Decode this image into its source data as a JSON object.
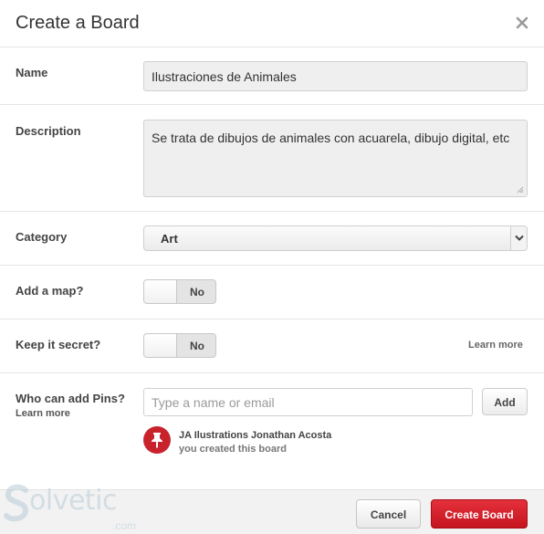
{
  "dialog": {
    "title": "Create a Board"
  },
  "name_field": {
    "label": "Name",
    "value": "Ilustraciones de Animales"
  },
  "description_field": {
    "label": "Description",
    "value": "Se trata de dibujos de animales con acuarela, dibujo digital, etc"
  },
  "category_field": {
    "label": "Category",
    "selected": "Art"
  },
  "map_field": {
    "label": "Add a map?",
    "state": "No"
  },
  "secret_field": {
    "label": "Keep it secret?",
    "state": "No",
    "learn_more": "Learn more"
  },
  "collaborators": {
    "label": "Who can add Pins?",
    "learn_more": "Learn more",
    "placeholder": "Type a name or email",
    "add_label": "Add",
    "owner_name": "JA Ilustrations Jonathan Acosta",
    "owner_note": "you created this board"
  },
  "footer": {
    "cancel_label": "Cancel",
    "create_label": "Create Board"
  },
  "watermark": {
    "brand": "olvetic",
    "domain": ".com"
  },
  "colors": {
    "primary": "#c8232c",
    "border": "#e6e6e6",
    "footer_bg": "#f2f2f2"
  },
  "icons": [
    "close-icon",
    "select-arrow-icon",
    "resize-grip-icon",
    "pushpin-icon"
  ]
}
